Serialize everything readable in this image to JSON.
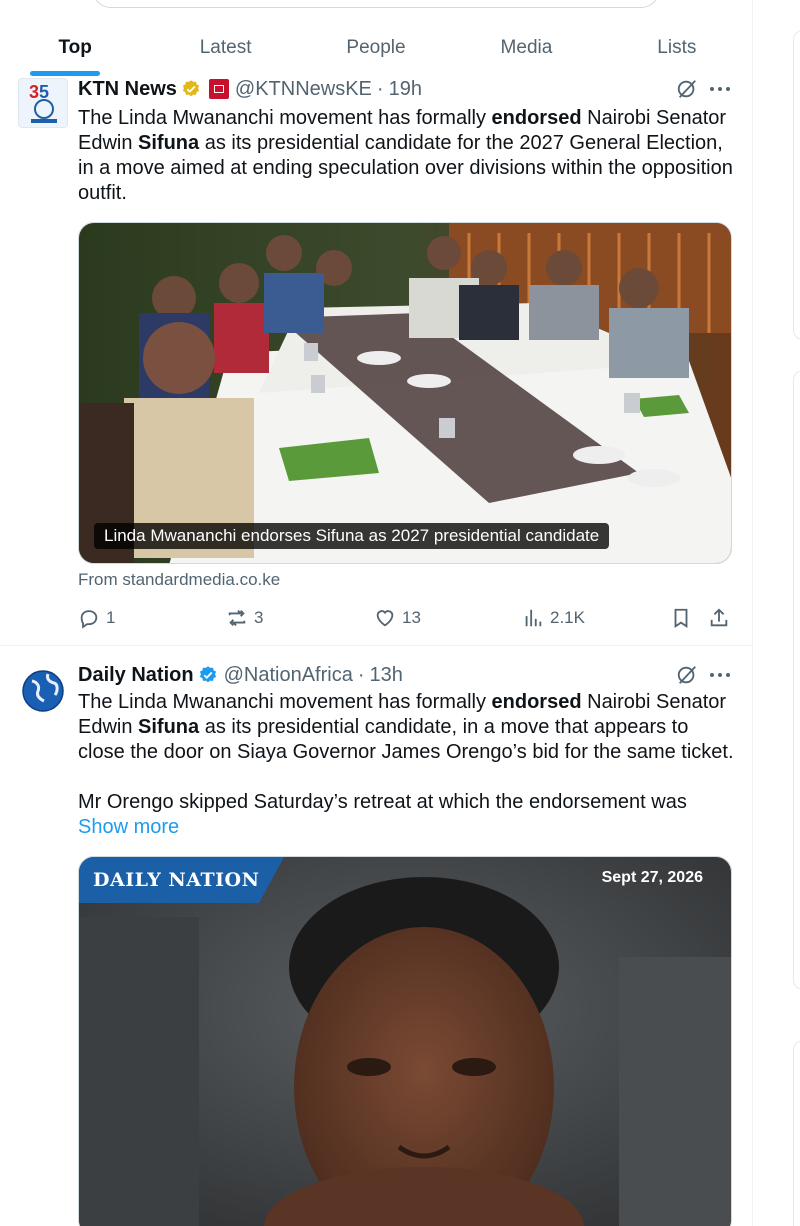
{
  "tabs": [
    {
      "label": "Top",
      "active": true
    },
    {
      "label": "Latest",
      "active": false
    },
    {
      "label": "People",
      "active": false
    },
    {
      "label": "Media",
      "active": false
    },
    {
      "label": "Lists",
      "active": false
    }
  ],
  "colors": {
    "accent": "#1d9bf0",
    "text": "#0f1419",
    "muted": "#536471",
    "verified_gold": "#e2b719",
    "verified_blue": "#1d9bf0"
  },
  "tweets": [
    {
      "author": "KTN News",
      "badge": "gold-verified-icon",
      "handle": "@KTNNewsKE",
      "dot": "·",
      "time": "19h",
      "text_parts": [
        "The Linda Mwananchi movement has formally ",
        "endorsed",
        " Nairobi Senator Edwin ",
        "Sifuna",
        " as its presidential candidate for the 2027 General Election, in a move aimed at ending speculation over divisions within the opposition outfit."
      ],
      "card_caption": "Linda Mwananchi endorses Sifuna as 2027 presidential candidate",
      "card_source": "From standardmedia.co.ke",
      "stats": {
        "replies": "1",
        "reposts": "3",
        "likes": "13",
        "views": "2.1K"
      }
    },
    {
      "author": "Daily Nation",
      "badge": "blue-verified-icon",
      "handle": "@NationAfrica",
      "dot": "·",
      "time": "13h",
      "text_parts": [
        "The Linda Mwananchi movement has formally ",
        "endorsed",
        " Nairobi Senator Edwin ",
        "Sifuna",
        " as its presidential candidate, in a move that appears to close the door on Siaya Governor James Orengo’s bid for the same ticket."
      ],
      "text_para2": "Mr Orengo skipped Saturday’s retreat at which the endorsement was",
      "show_more": "Show more",
      "image_logo": "DAILY NATION",
      "image_date": "Sept 27, 2026"
    }
  ]
}
